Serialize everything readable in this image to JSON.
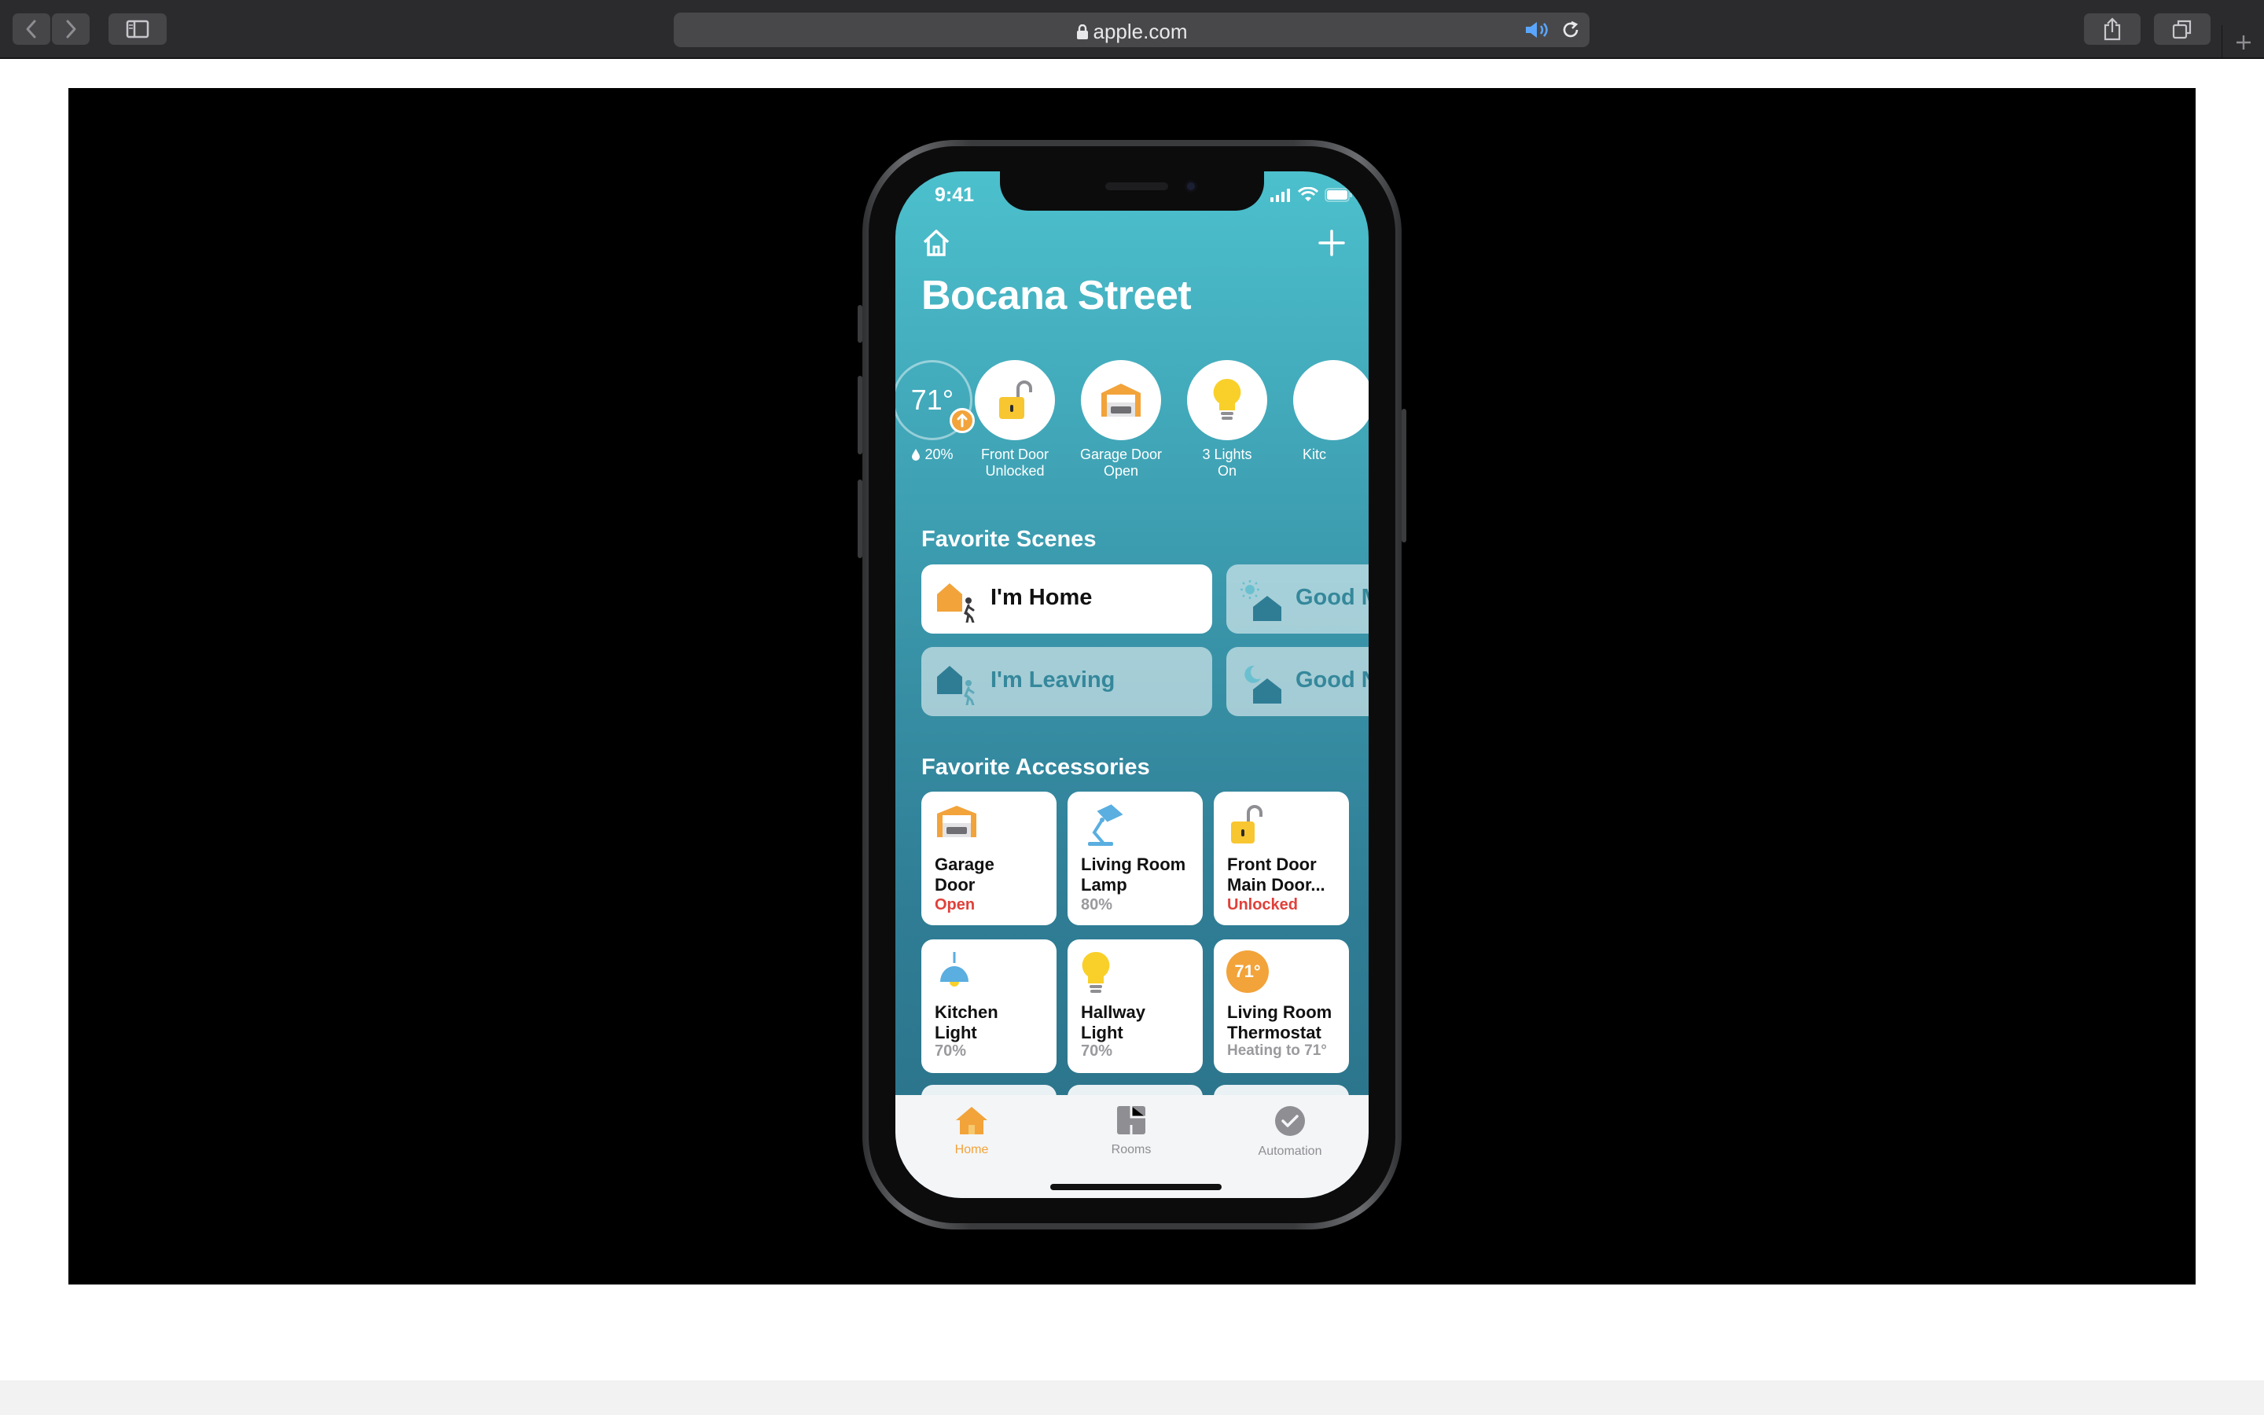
{
  "browser": {
    "url": "apple.com",
    "buttons": {
      "back": "chevron-left-icon",
      "forward": "chevron-right-icon",
      "sidebar": "sidebar-icon",
      "share": "share-icon",
      "tabs": "tabs-icon",
      "new_tab": "plus-icon"
    }
  },
  "phone": {
    "time": "9:41",
    "home_name": "Bocana Street",
    "status_items": [
      {
        "icon": "thermostat",
        "value": "71°",
        "humidity": "20%"
      },
      {
        "icon": "lock-open-icon",
        "label_line1": "Front Door",
        "label_line2": "Unlocked"
      },
      {
        "icon": "garage-icon",
        "label_line1": "Garage Door",
        "label_line2": "Open"
      },
      {
        "icon": "bulb-icon",
        "label_line1": "3 Lights",
        "label_line2": "On"
      },
      {
        "icon": "partial",
        "label_line1": "Kitc"
      }
    ],
    "favorite_scenes_title": "Favorite Scenes",
    "scenes": [
      {
        "label": "I'm Home",
        "active": true
      },
      {
        "label": "Good M",
        "active": false
      },
      {
        "label": "I'm Leaving",
        "active": false
      },
      {
        "label": "Good N",
        "active": false
      }
    ],
    "favorite_accessories_title": "Favorite Accessories",
    "accessories": [
      {
        "name1": "Garage",
        "name2": "Door",
        "state": "Open",
        "alert": true,
        "icon": "garage-icon"
      },
      {
        "name1": "Living Room",
        "name2": "Lamp",
        "state": "80%",
        "alert": false,
        "icon": "lamp-icon"
      },
      {
        "name1": "Front Door",
        "name2": "Main Door...",
        "state": "Unlocked",
        "alert": true,
        "icon": "lock-open-icon"
      },
      {
        "name1": "Kitchen",
        "name2": "Light",
        "state": "70%",
        "alert": false,
        "icon": "pendant-light-icon"
      },
      {
        "name1": "Hallway",
        "name2": "Light",
        "state": "70%",
        "alert": false,
        "icon": "bulb-icon"
      },
      {
        "name1": "Living Room",
        "name2": "Thermostat",
        "state": "Heating to 71°",
        "alert": false,
        "icon": "thermostat-icon",
        "badge": "71°"
      }
    ],
    "tabs": [
      {
        "label": "Home",
        "active": true,
        "icon": "house-icon"
      },
      {
        "label": "Rooms",
        "active": false,
        "icon": "rooms-icon"
      },
      {
        "label": "Automation",
        "active": false,
        "icon": "automation-icon"
      }
    ]
  },
  "colors": {
    "accent_orange": "#f2a33a",
    "alert_red": "#e0403a",
    "screen_teal": "#42aabb",
    "scene_inactive_text": "#35889b"
  }
}
